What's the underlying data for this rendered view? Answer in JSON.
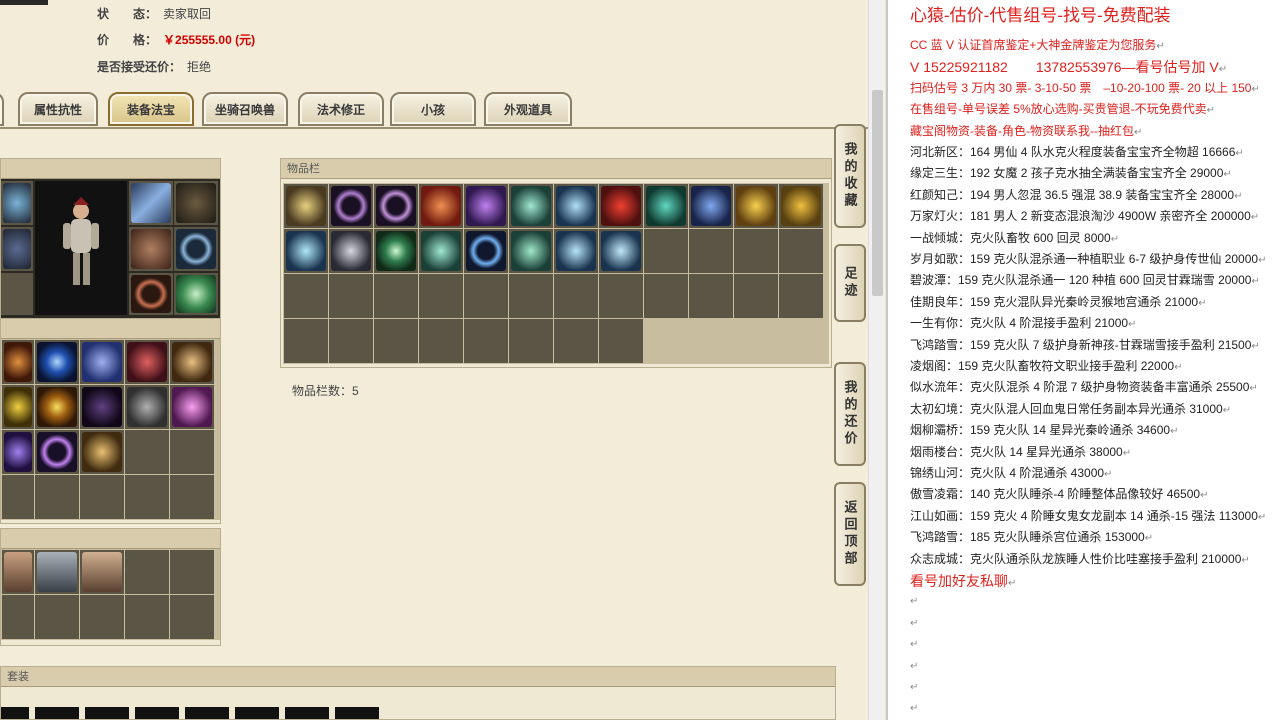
{
  "left": {
    "status_label": "状　　态：",
    "status_value": "卖家取回",
    "price_label": "价　　格：",
    "price_value": "￥255555.00 (元)",
    "bargain_label": "是否接受还价：",
    "bargain_value": "拒绝",
    "tabs": [
      "属性抗性",
      "装备法宝",
      "坐骑召唤兽",
      "法术修正",
      "小孩",
      "外观道具"
    ],
    "items_panel_title": "物品栏",
    "items_count": "物品栏数：5",
    "suit_panel_title": "套装",
    "sidenav": [
      "我的收藏",
      "足迹",
      "我的还价",
      "返回顶部"
    ]
  },
  "colors": {
    "price_red": "#d40000",
    "title_red": "#e0201c",
    "tab_active": "#d8c48a"
  },
  "right": {
    "title": "心猿-估价-代售组号-找号-免费配装",
    "lines": [
      {
        "text": "CC 蓝 V 认证首席鉴定+大神金牌鉴定为您服务",
        "red": true
      },
      {
        "text": "V 15225921182　　13782553976—看号估号加 V",
        "red": true,
        "big": true
      },
      {
        "text": "扫码估号 3 万内 30 票- 3-10-50 票　–10-20-100 票- 20 以上 150",
        "red": true
      },
      {
        "text": "在售组号-单号误差 5%放心选购-买贵管退-不玩免费代卖",
        "red": true
      },
      {
        "text": "藏宝阁物资-装备-角色-物资联系我--抽红包",
        "red": true
      },
      {
        "text": "河北新区：164 男仙 4 队水克火程度装备宝宝齐全物超 16666"
      },
      {
        "text": "缘定三生：192 女魔 2 孩子克水抽全满装备宝宝齐全 29000"
      },
      {
        "text": "红颜知己：194 男人忽混 36.5 强混 38.9 装备宝宝齐全 28000"
      },
      {
        "text": "万家灯火：181 男人 2 新变态混浪淘沙 4900W 亲密齐全 200000"
      },
      {
        "text": "一战倾城：克火队畜牧 600 回灵 8000"
      },
      {
        "text": "岁月如歌：159 克火队混杀通一种植职业 6-7 级护身传世仙 20000"
      },
      {
        "text": "碧波潭：159 克火队混杀通一 120 种植 600 回灵甘霖瑞雪 20000"
      },
      {
        "text": "佳期良年：159 克火混队异光秦岭灵猴地宫通杀 21000"
      },
      {
        "text": "一生有你：克火队 4 阶混接手盈利 21000"
      },
      {
        "text": "飞鸿踏雪：159 克火队 7 级护身新神孩-甘霖瑞雪接手盈利 21500"
      },
      {
        "text": "凌烟阁：159 克火队畜牧符文职业接手盈利 22000"
      },
      {
        "text": "似水流年：克火队混杀 4 阶混 7 级护身物资装备丰富通杀 25500"
      },
      {
        "text": "太初幻境：克火队混人回血鬼日常任务副本异光通杀 31000"
      },
      {
        "text": "烟柳灞桥：159 克火队 14 星异光秦岭通杀 34600"
      },
      {
        "text": "烟雨楼台：克火队 14 星异光通杀 38000"
      },
      {
        "text": "锦绣山河：克火队 4 阶混通杀 43000"
      },
      {
        "text": "傲雪凌霜：140 克火队睡杀-4 阶睡整体品像较好 46500"
      },
      {
        "text": "江山如画：159 克火 4 阶睡女鬼女龙副本 14 通杀-15 强法 113000"
      },
      {
        "text": "飞鸿踏雪：185 克火队睡杀宫位通杀 153000"
      },
      {
        "text": "众志成城：克火队通杀队龙族睡人性价比哇塞接手盈利 210000"
      },
      {
        "text": "看号加好友私聊",
        "red": true,
        "big": true
      }
    ],
    "para_mark": "↵"
  }
}
